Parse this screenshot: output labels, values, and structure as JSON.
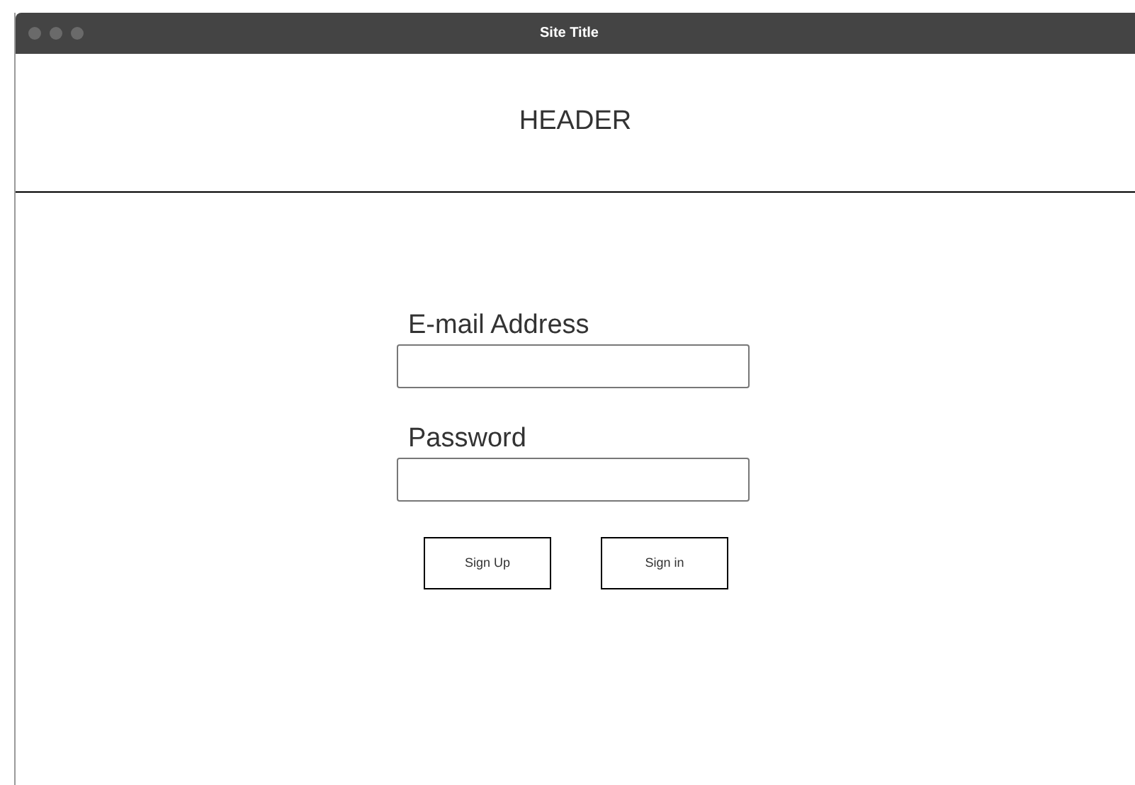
{
  "window": {
    "title": "Site Title"
  },
  "header": {
    "text": "HEADER"
  },
  "form": {
    "fields": [
      {
        "label": "E-mail Address"
      },
      {
        "label": "Password"
      }
    ],
    "buttons": [
      "Sign Up",
      "Sign in"
    ]
  }
}
